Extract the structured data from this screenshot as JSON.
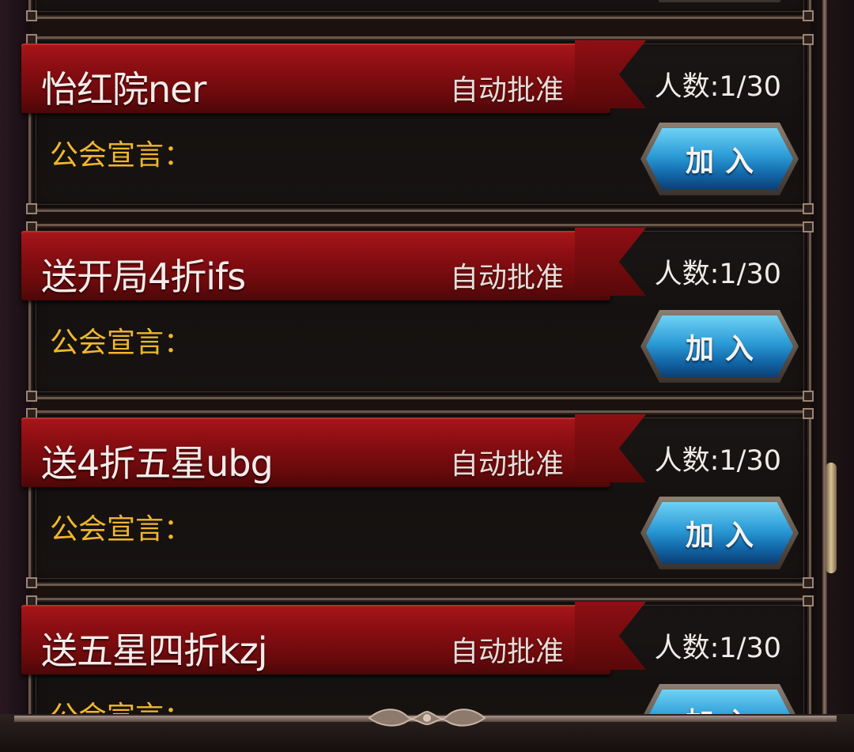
{
  "guilds": [
    {
      "name": "",
      "auto": "",
      "count": "",
      "declaration_label": "",
      "join_label": ""
    },
    {
      "name": "怡红院ner",
      "auto": "自动批准",
      "count": "人数:1/30",
      "declaration_label": "公会宣言：",
      "join_label": "加入"
    },
    {
      "name": "送开局4折ifs",
      "auto": "自动批准",
      "count": "人数:1/30",
      "declaration_label": "公会宣言：",
      "join_label": "加入"
    },
    {
      "name": "送4折五星ubg",
      "auto": "自动批准",
      "count": "人数:1/30",
      "declaration_label": "公会宣言：",
      "join_label": "加入"
    },
    {
      "name": "送五星四折kzj",
      "auto": "自动批准",
      "count": "人数:1/30",
      "declaration_label": "公会宣言：",
      "join_label": "加入"
    }
  ],
  "colors": {
    "banner": "#8a0e12",
    "declaration": "#f1b62e",
    "button": "#2b9bd6"
  }
}
